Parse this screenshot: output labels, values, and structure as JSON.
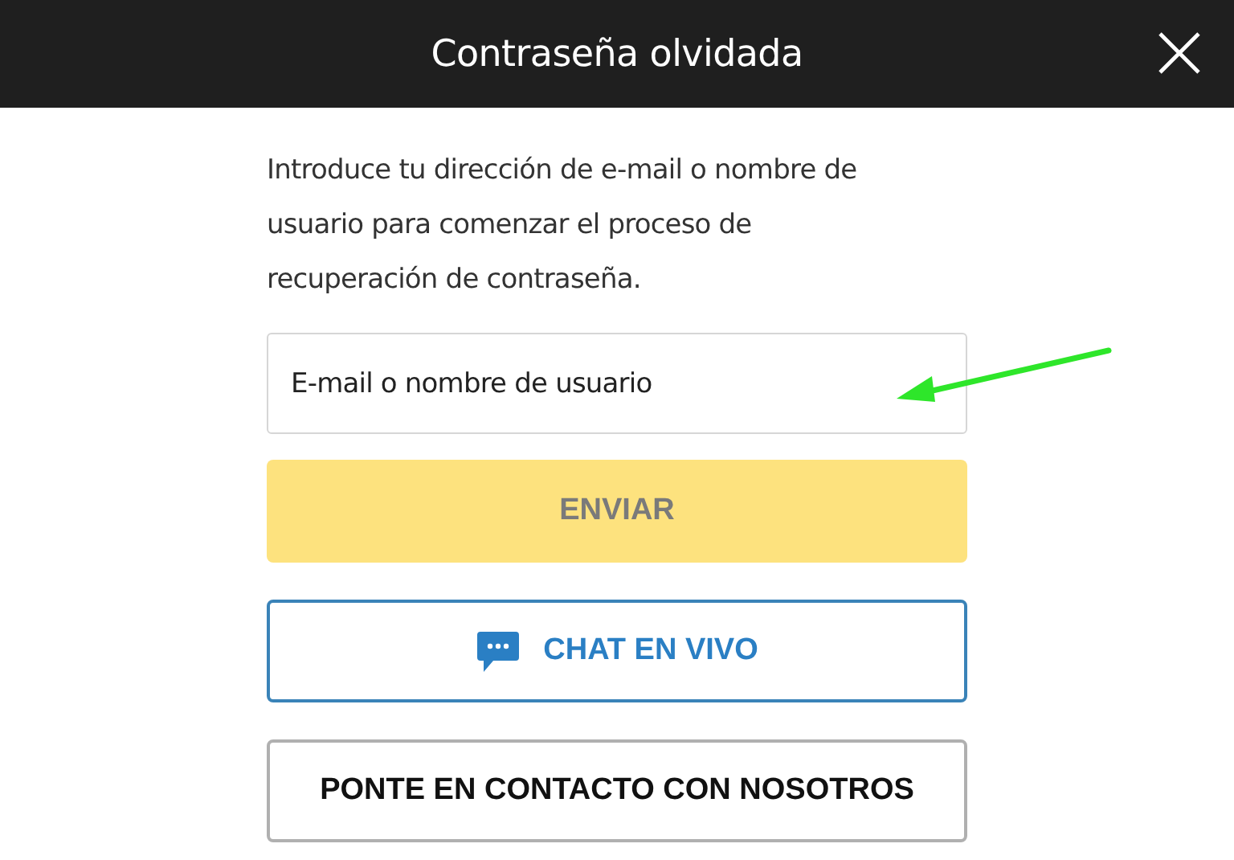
{
  "header": {
    "title": "Contraseña olvidada"
  },
  "intro": "Introduce tu dirección de e-mail o nombre de usuario para comenzar el proceso de recuperación de contraseña.",
  "field": {
    "placeholder": "E-mail o nombre de usuario"
  },
  "buttons": [
    {
      "label": "ENVIAR",
      "kind": "primary",
      "disabled": true
    },
    {
      "label": "CHAT EN VIVO",
      "kind": "chat",
      "disabled": false
    },
    {
      "label": "PONTE EN CONTACTO CON NOSOTROS",
      "kind": "outline",
      "disabled": false
    }
  ]
}
